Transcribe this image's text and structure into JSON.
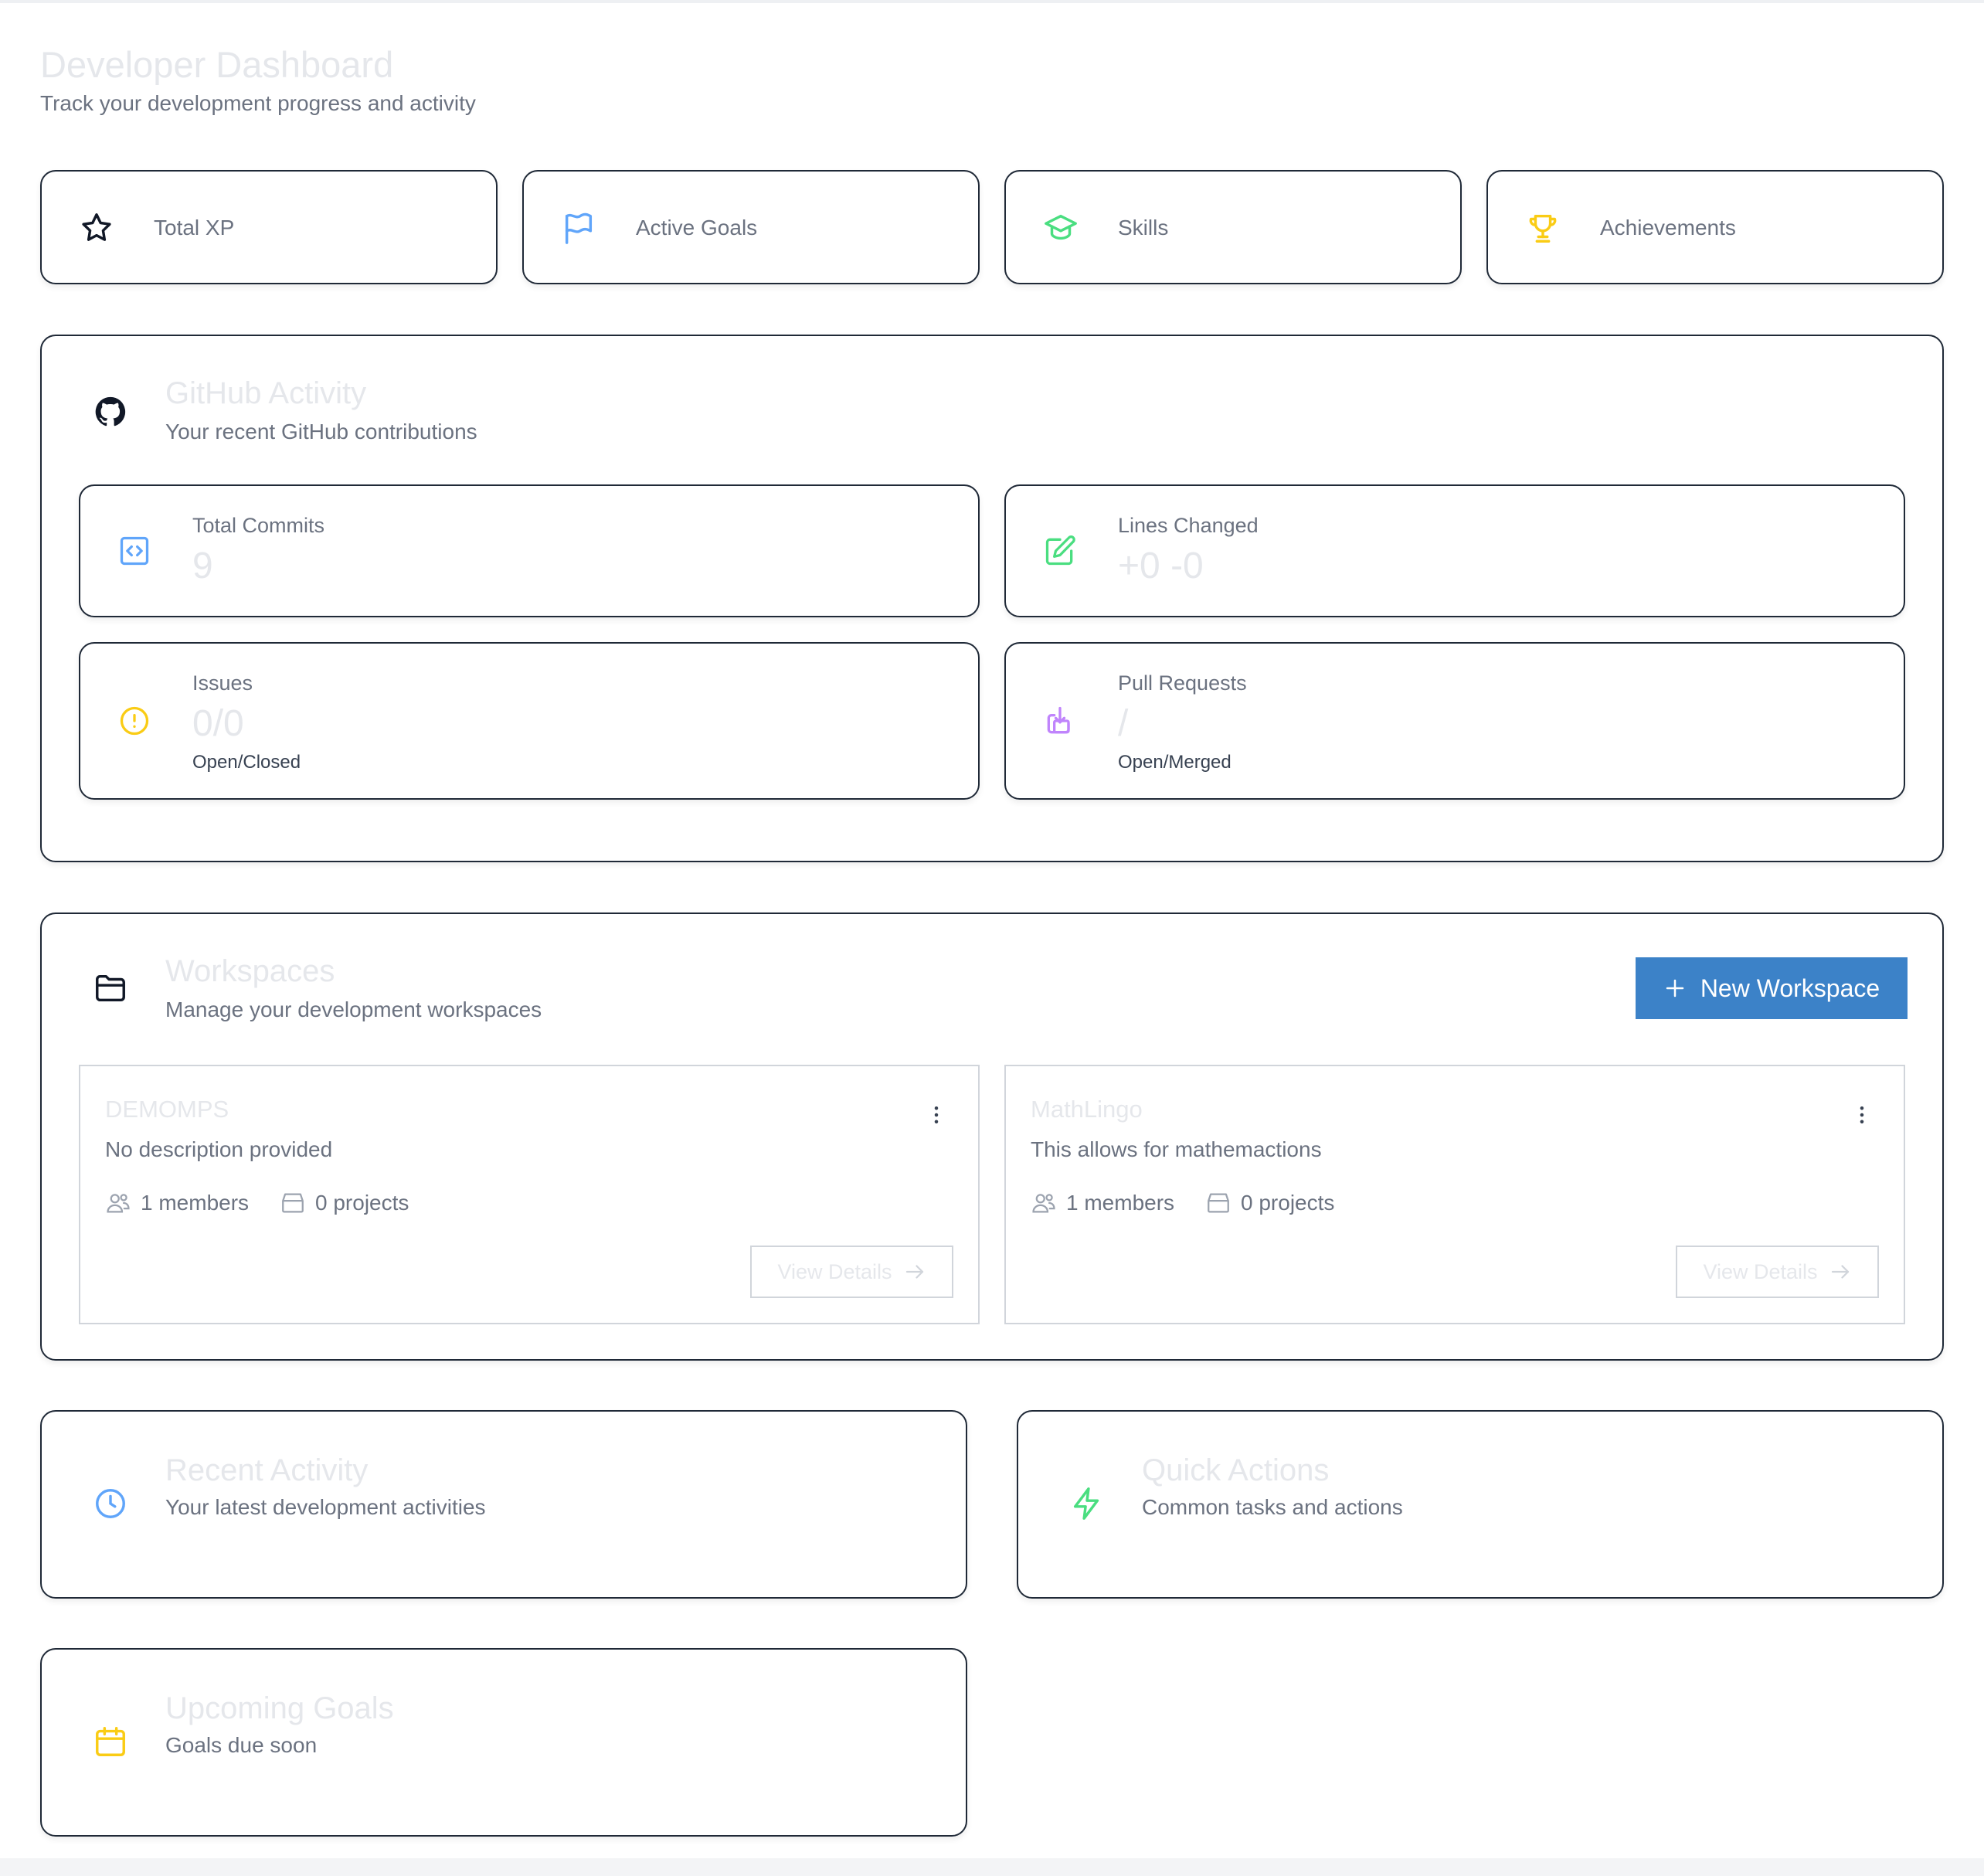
{
  "header": {
    "title": "Developer Dashboard",
    "subtitle": "Track your development progress and activity"
  },
  "stats": [
    {
      "label": "Total XP",
      "icon": "star-icon"
    },
    {
      "label": "Active Goals",
      "icon": "flag-icon"
    },
    {
      "label": "Skills",
      "icon": "graduation-cap-icon"
    },
    {
      "label": "Achievements",
      "icon": "trophy-icon"
    }
  ],
  "github": {
    "title": "GitHub Activity",
    "subtitle": "Your recent GitHub contributions",
    "total_commits": {
      "label": "Total Commits",
      "value": "9"
    },
    "lines_changed": {
      "label": "Lines Changed",
      "value": "+0 -0"
    },
    "issues": {
      "label": "Issues",
      "value": "0/0",
      "caption": "Open/Closed"
    },
    "pull_requests": {
      "label": "Pull Requests",
      "value": "/",
      "caption": "Open/Merged"
    }
  },
  "workspaces": {
    "title": "Workspaces",
    "subtitle": "Manage your development workspaces",
    "new_button_label": "New Workspace",
    "items": [
      {
        "name": "DEMOMPS",
        "description": "No description provided",
        "members": "1 members",
        "projects": "0 projects",
        "view_label": "View Details"
      },
      {
        "name": "MathLingo",
        "description": "This allows for mathemactions",
        "members": "1 members",
        "projects": "0 projects",
        "view_label": "View Details"
      }
    ]
  },
  "recent_activity": {
    "title": "Recent Activity",
    "subtitle": "Your latest development activities"
  },
  "quick_actions": {
    "title": "Quick Actions",
    "subtitle": "Common tasks and actions"
  },
  "upcoming_goals": {
    "title": "Upcoming Goals",
    "subtitle": "Goals due soon"
  },
  "colors": {
    "primary_button": "#3c82c8",
    "blue_icon": "#60a5fa",
    "green_icon": "#4ade80",
    "yellow_icon": "#facc15",
    "purple_icon": "#c084fc",
    "muted_heading": "#e5e7eb"
  }
}
